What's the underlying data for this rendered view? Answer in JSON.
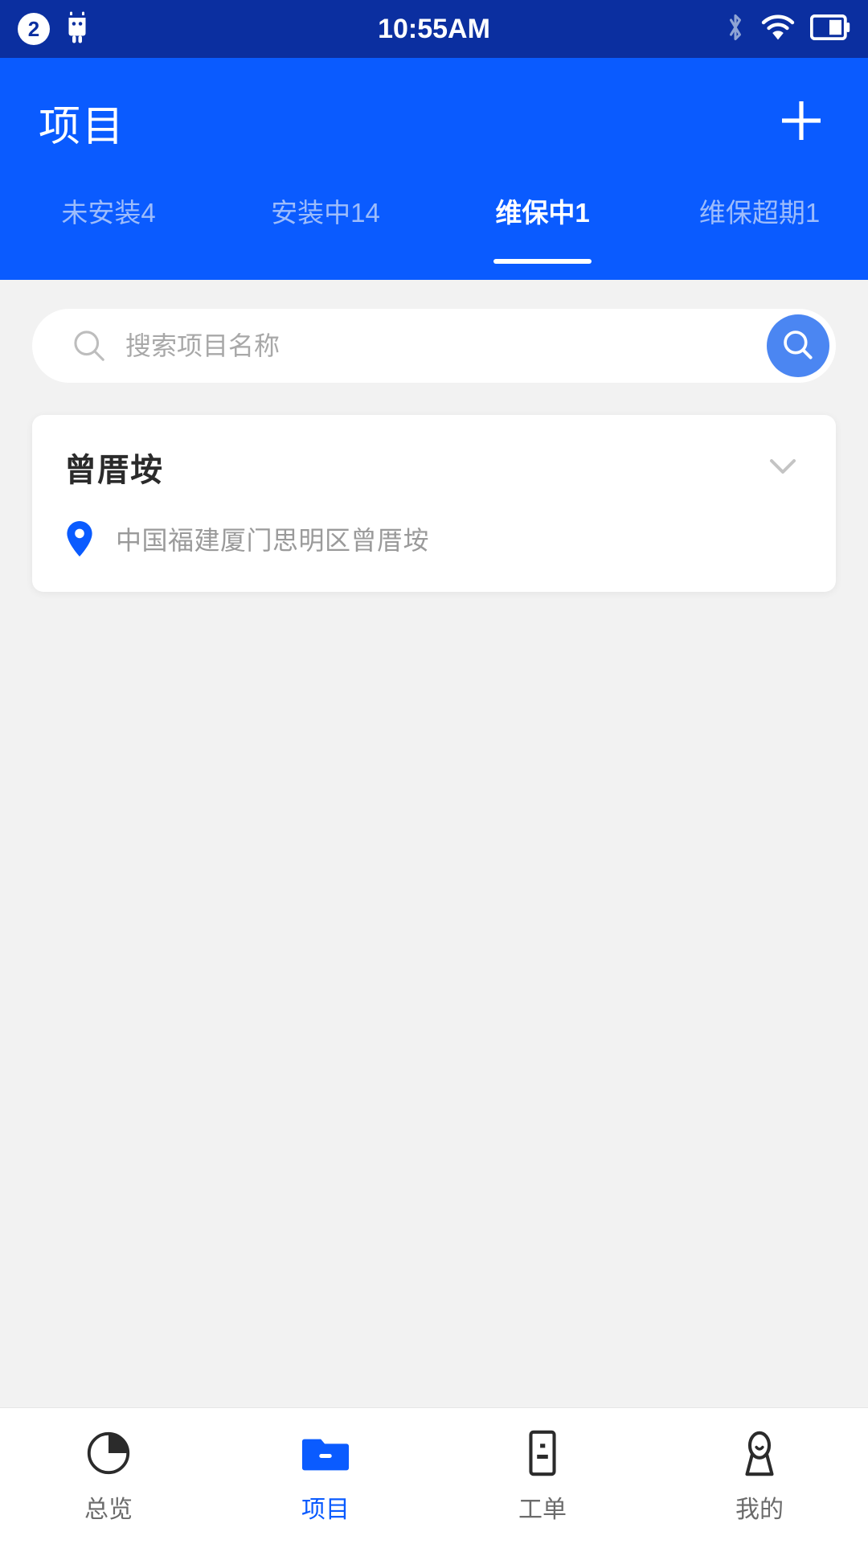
{
  "status_bar": {
    "notification_count": "2",
    "time": "10:55AM",
    "icons": [
      "android-robot-icon",
      "bluetooth-icon",
      "wifi-icon",
      "battery-icon"
    ]
  },
  "header": {
    "title": "项目",
    "add_button": "+",
    "background_color": "#0a5bff",
    "tabs": [
      {
        "label": "未安装4",
        "active": false
      },
      {
        "label": "安装中14",
        "active": false
      },
      {
        "label": "维保中1",
        "active": true
      },
      {
        "label": "维保超期1",
        "active": false
      }
    ]
  },
  "search": {
    "placeholder": "搜索项目名称",
    "value": "",
    "button_icon": "search-icon",
    "button_color": "#4b86f2"
  },
  "projects": [
    {
      "name": "曾厝垵",
      "address": "中国福建厦门思明区曾厝垵",
      "expand_icon": "chevron-down-icon",
      "pin_icon": "map-pin-icon",
      "pin_color": "#0a5bff"
    }
  ],
  "bottom_nav": {
    "active_color": "#0a5bff",
    "inactive_color": "#6b6b6b",
    "items": [
      {
        "label": "总览",
        "icon": "pie-chart-icon",
        "active": false
      },
      {
        "label": "项目",
        "icon": "folder-icon",
        "active": true
      },
      {
        "label": "工单",
        "icon": "work-order-icon",
        "active": false
      },
      {
        "label": "我的",
        "icon": "person-icon",
        "active": false
      }
    ]
  }
}
